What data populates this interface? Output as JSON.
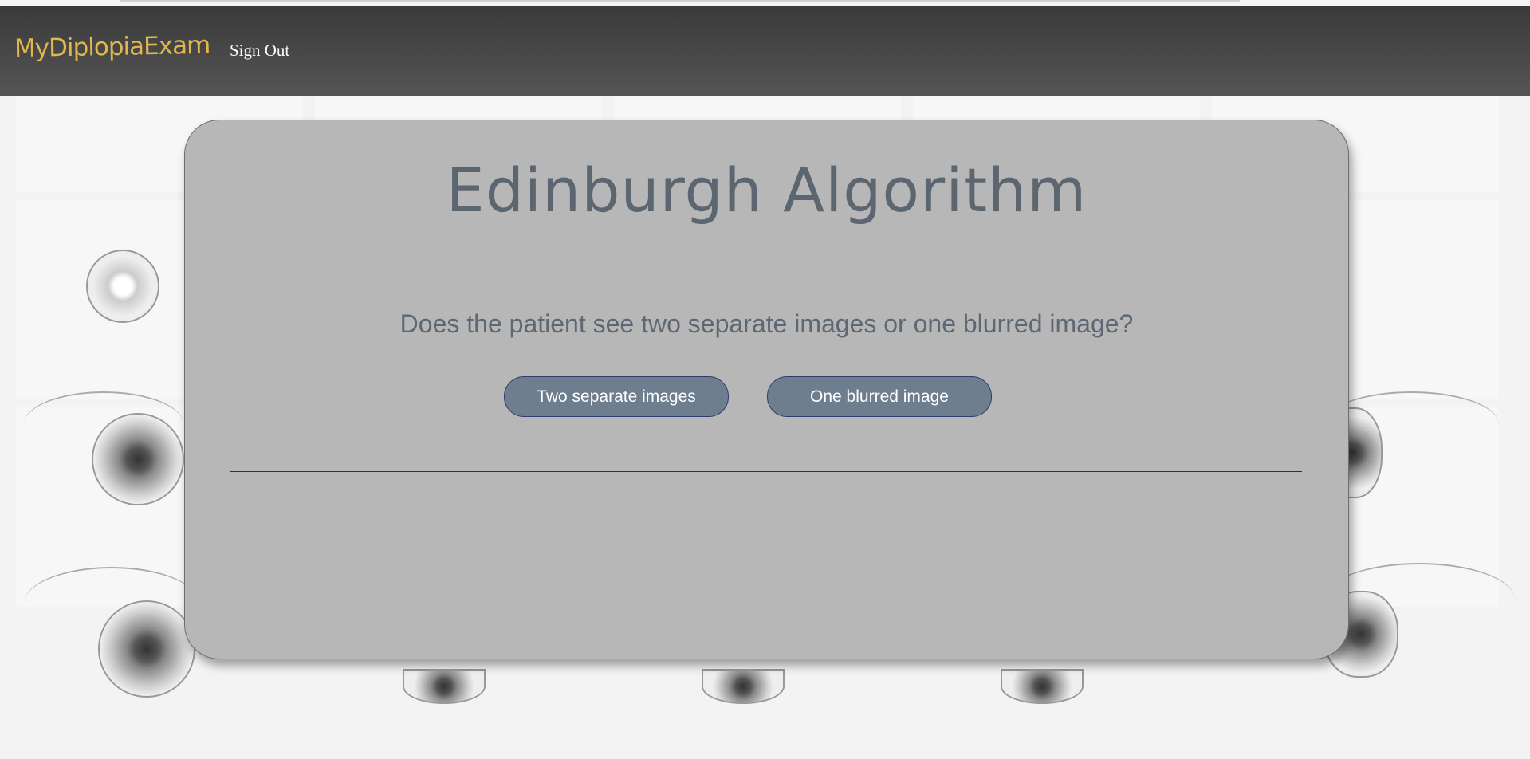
{
  "navbar": {
    "brand": "MyDiplopiaExam",
    "signout_label": "Sign Out"
  },
  "card": {
    "title": "Edinburgh Algorithm",
    "question": "Does the patient see two separate images or one blurred image?",
    "buttons": [
      {
        "label": "Two separate images"
      },
      {
        "label": "One blurred image"
      }
    ]
  },
  "colors": {
    "navbar": "#444444",
    "brand": "#e0b64e",
    "card": "#b7b7b7",
    "title": "#5c6670",
    "button": "#6e7e8e"
  }
}
